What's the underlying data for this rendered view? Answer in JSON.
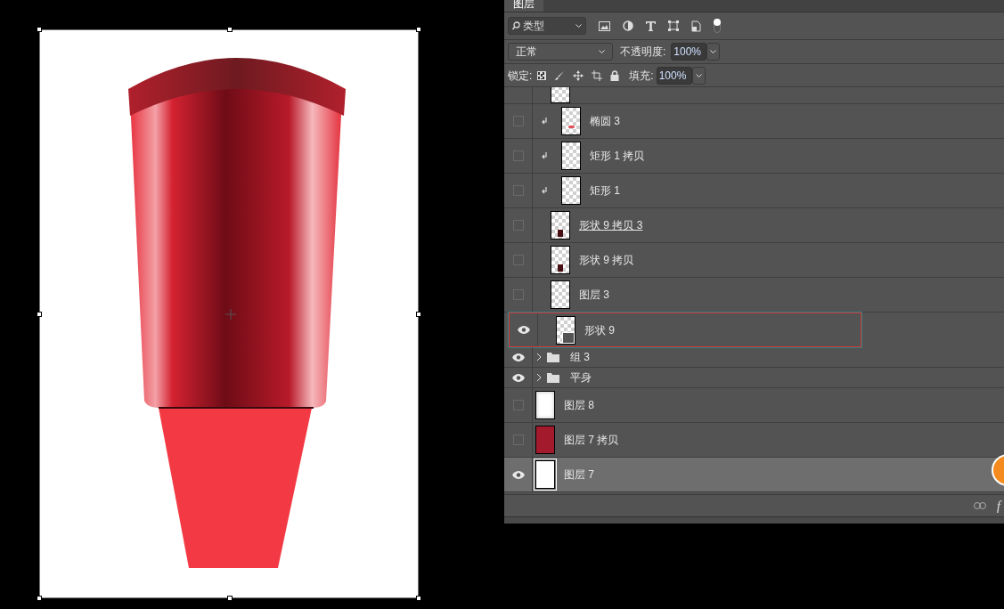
{
  "panel": {
    "tab": "图层",
    "filter": {
      "value": "类型",
      "toggle_on": true
    },
    "blend": {
      "mode": "正常",
      "opacity_label": "不透明度:",
      "opacity": "100%"
    },
    "lock": {
      "label": "锁定:",
      "fill_label": "填充:",
      "fill": "100%"
    }
  },
  "open_group_layers": [
    {
      "name": "椭圆 3",
      "visible": false,
      "clipped": true,
      "underlined": false,
      "outlined": false,
      "thumb": {
        "kind": "red-dot"
      }
    },
    {
      "name": "矩形 1 拷贝",
      "visible": false,
      "clipped": true,
      "underlined": false,
      "outlined": false,
      "thumb": {
        "kind": "empty"
      }
    },
    {
      "name": "矩形 1",
      "visible": false,
      "clipped": true,
      "underlined": false,
      "outlined": false,
      "thumb": {
        "kind": "empty"
      }
    },
    {
      "name": "形状 9 拷贝 3",
      "visible": false,
      "clipped": false,
      "underlined": true,
      "outlined": false,
      "thumb": {
        "kind": "cup"
      }
    },
    {
      "name": "形状 9 拷贝",
      "visible": false,
      "clipped": false,
      "underlined": false,
      "outlined": false,
      "thumb": {
        "kind": "cup"
      }
    },
    {
      "name": "图层 3",
      "visible": false,
      "clipped": false,
      "underlined": false,
      "outlined": false,
      "thumb": {
        "kind": "empty"
      }
    },
    {
      "name": "形状 9",
      "visible": true,
      "clipped": false,
      "underlined": false,
      "outlined": true,
      "thumb": {
        "kind": "shape"
      }
    }
  ],
  "layers": [
    {
      "kind": "group",
      "name": "组 3",
      "visible": true,
      "selected": false,
      "expanded": false
    },
    {
      "kind": "group",
      "name": "平身",
      "visible": true,
      "selected": false,
      "expanded": false
    },
    {
      "kind": "layer",
      "name": "图层 8",
      "visible": false,
      "selected": false,
      "thumb": {
        "kind": "white-blur"
      }
    },
    {
      "kind": "layer",
      "name": "图层 7 拷贝",
      "visible": false,
      "selected": false,
      "thumb": {
        "kind": "solid",
        "color": "#a31a2c"
      }
    },
    {
      "kind": "layer",
      "name": "图层 7",
      "visible": true,
      "selected": true,
      "thumb": {
        "kind": "white"
      }
    }
  ],
  "footer": {
    "fx_label": "f"
  }
}
